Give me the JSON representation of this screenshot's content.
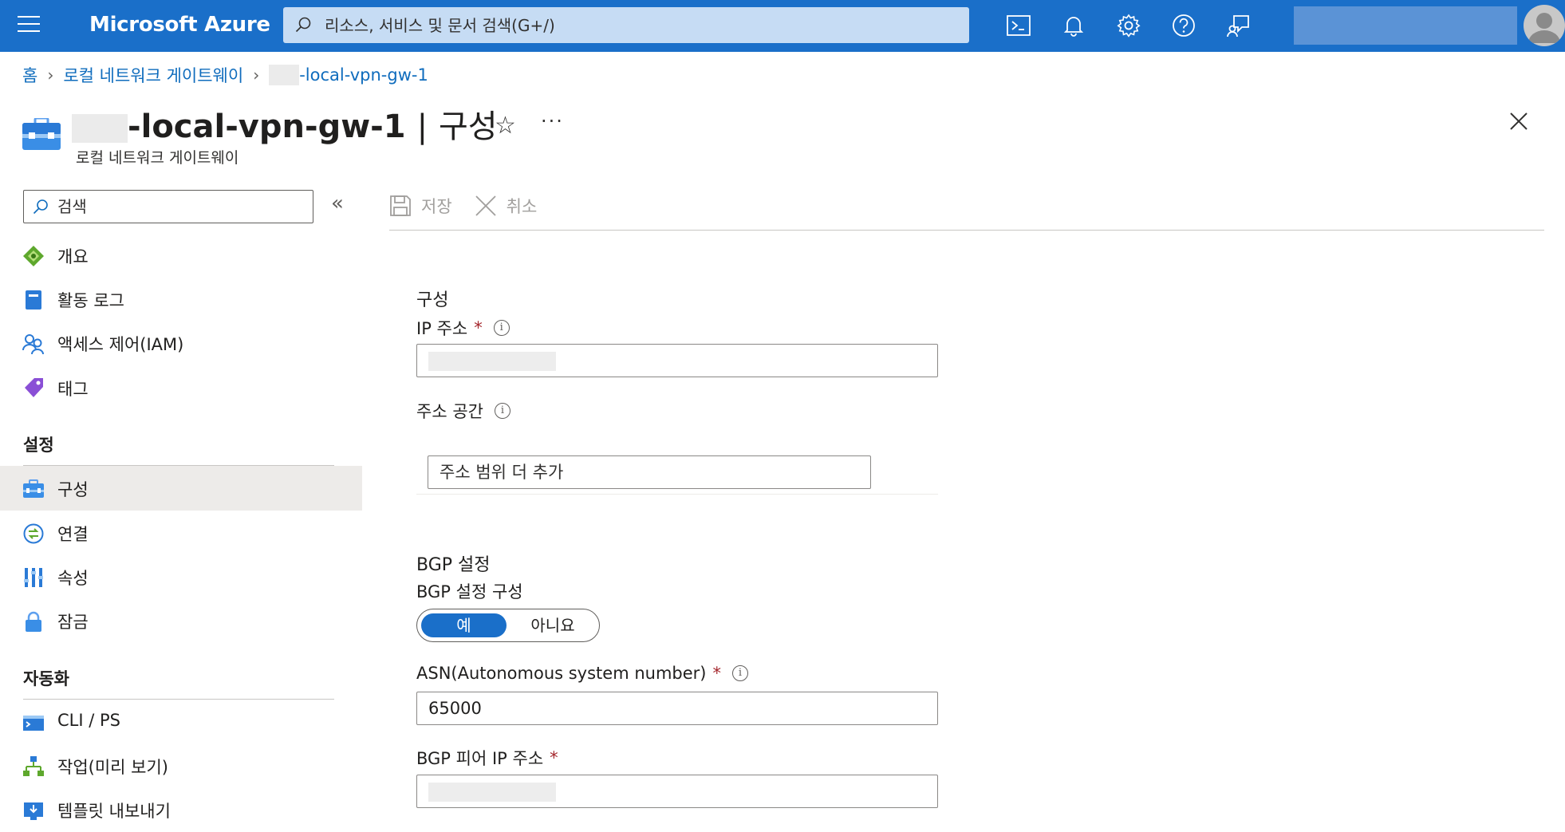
{
  "topbar": {
    "brand": "Microsoft Azure",
    "search_placeholder": "리소스, 서비스 및 문서 검색(G+/)",
    "accent": "#1a6fc9"
  },
  "breadcrumb": {
    "home": "홈",
    "parent": "로컬 네트워크 게이트웨이",
    "current": "-local-vpn-gw-1"
  },
  "header": {
    "title_name": "-local-vpn-gw-1",
    "title_sep": "|",
    "title_page": "구성",
    "subtitle": "로컬 네트워크 게이트웨이",
    "star": "☆",
    "more": "···"
  },
  "sidebar": {
    "search_placeholder": "검색",
    "collapse": "«",
    "items_top": [
      "개요",
      "활동 로그",
      "액세스 제어(IAM)",
      "태그"
    ],
    "section_settings": "설정",
    "items_settings": [
      "구성",
      "연결",
      "속성",
      "잠금"
    ],
    "section_automation": "자동화",
    "items_automation": [
      "CLI / PS",
      "작업(미리 보기)",
      "템플릿 내보내기"
    ]
  },
  "toolbar": {
    "save": "저장",
    "cancel": "취소"
  },
  "form": {
    "section_config": "구성",
    "ip_label": "IP 주소",
    "ip_value": "",
    "address_space_label": "주소 공간",
    "address_range_placeholder": "주소 범위 더 추가",
    "section_bgp": "BGP 설정",
    "bgp_configure_label": "BGP 설정 구성",
    "bgp_yes": "예",
    "bgp_no": "아니요",
    "bgp_selected": "예",
    "asn_label": "ASN(Autonomous system number)",
    "asn_value": "65000",
    "bgp_peer_label": "BGP 피어 IP 주소",
    "bgp_peer_value": "",
    "required_mark": "*",
    "info_glyph": "i"
  }
}
